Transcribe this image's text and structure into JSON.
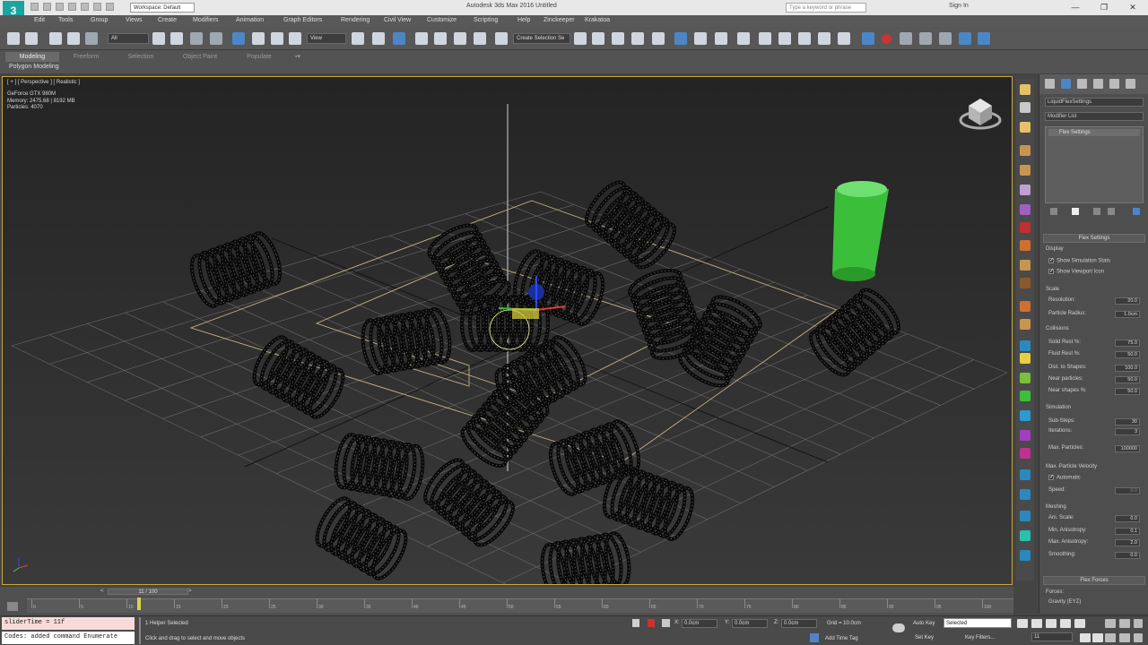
{
  "titlebar": {
    "logo": "3",
    "workspace": "Workspace: Default",
    "app_title": "Autodesk 3ds Max 2016    Untitled",
    "search_placeholder": "Type a keyword or phrase",
    "signin": "Sign In",
    "minimize": "—",
    "restore": "❐",
    "close": "✕"
  },
  "menu": [
    "Edit",
    "Tools",
    "Group",
    "Views",
    "Create",
    "Modifiers",
    "Animation",
    "Graph Editors",
    "Rendering",
    "Civil View",
    "Customize",
    "Scripting",
    "Help",
    "Zinckeeper",
    "Krakatoa"
  ],
  "toolbar": {
    "filter_value": "All",
    "refcoord_value": "View",
    "named_selection_placeholder": "Create Selection Se"
  },
  "ribbon": {
    "tabs": [
      "Modeling",
      "Freeform",
      "Selection",
      "Object Paint",
      "Populate"
    ],
    "active_tab": "Modeling",
    "subpanel": "Polygon Modeling"
  },
  "viewport": {
    "label": "[ + ] [ Perspective ] [ Realistic ]",
    "stats": [
      "GeForce GTX 980M",
      "Memory: 2475.68 | 8192 MB",
      "Particles: 4070"
    ]
  },
  "command_panel": {
    "object_name": "LiquidFlexSettings",
    "modifier_list": "Modifier List",
    "stack_item": "Flex Settings",
    "rollout_title": "Flex Settings",
    "display": {
      "title": "Display",
      "show_sim_stats": "Show Simulation Stats",
      "show_viewport_icon": "Show Viewport Icon"
    },
    "scale": {
      "title": "Scale",
      "resolution_label": "Resolution:",
      "resolution_value": "20.0",
      "particle_radius_label": "Particle Radius:",
      "particle_radius_value": "1.0cm"
    },
    "collisions": {
      "title": "Collisions",
      "solid_rest_label": "Solid Rest %:",
      "solid_rest_value": "75.0",
      "fluid_rest_label": "Fluid Rest %:",
      "fluid_rest_value": "50.0",
      "dist_shapes_label": "Dist. to Shapes:",
      "dist_shapes_value": "100.0",
      "near_particles_label": "Near particles:",
      "near_particles_value": "50.0",
      "near_shapes_label": "Near shapes %:",
      "near_shapes_value": "50.0"
    },
    "simulation": {
      "title": "Simulation",
      "substeps_label": "Sub-Steps:",
      "substeps_value": "30",
      "iterations_label": "Iterations:",
      "iterations_value": "3",
      "max_particles_label": "Max. Particles:",
      "max_particles_value": "100000"
    },
    "max_particle_velocity": {
      "title": "Max. Particle Velocity",
      "automatic": "Automatic",
      "speed_label": "Speed:",
      "speed_value": "0.0"
    },
    "meshing": {
      "title": "Meshing",
      "ani_scale_label": "Ani. Scale:",
      "ani_scale_value": "0.0",
      "min_anisotropy_label": "Min. Anisotropy:",
      "min_anisotropy_value": "0.1",
      "max_anisotropy_label": "Max. Anisotropy:",
      "max_anisotropy_value": "2.0",
      "smoothing_label": "Smoothing:",
      "smoothing_value": "0.0"
    },
    "forces": {
      "rollout_title": "Flex Forces",
      "forces_label": "Forces:",
      "gravity_item": "Gravity (EYZ)"
    }
  },
  "timeline": {
    "slider_label": "11 / 100",
    "frame_ticks": [
      "0",
      "5",
      "10",
      "15",
      "20",
      "25",
      "30",
      "35",
      "40",
      "45",
      "50",
      "55",
      "60",
      "65",
      "70",
      "75",
      "80",
      "85",
      "90",
      "95",
      "100"
    ]
  },
  "status": {
    "maxscript_line1": "sliderTime = 11f",
    "maxscript_line2": "Codes: added command Enumerate",
    "selection": "1 Helper Selected",
    "prompt": "Click and drag to select and move objects",
    "x_label": "X:",
    "x_value": "0.0cm",
    "y_label": "Y:",
    "y_value": "0.0cm",
    "z_label": "Z:",
    "z_value": "0.0cm",
    "grid": "Grid = 10.0cm",
    "add_time_tag": "Add Time Tag",
    "auto_key": "Auto Key",
    "set_key": "Set Key",
    "key_mode": "Selected",
    "key_filters": "Key Filters...",
    "current_frame": "11"
  }
}
